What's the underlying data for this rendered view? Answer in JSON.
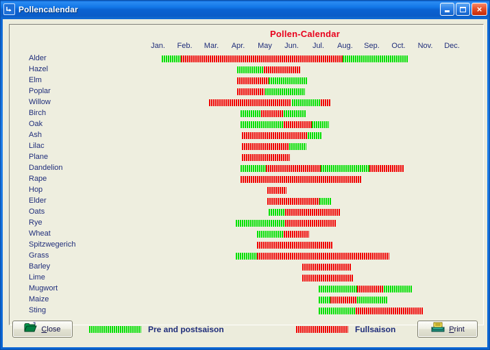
{
  "window": {
    "title": "Pollencalendar",
    "icon": "window-restore-icon",
    "minimize_label": "",
    "maximize_label": "",
    "close_label": "×"
  },
  "chart": {
    "title": "Pollen-Calendar",
    "title_color": "#E8001C",
    "label_color": "#1F2D7A",
    "background": "#EEEEDF",
    "pre_color": "#00E000",
    "full_color": "#F00000"
  },
  "legend": {
    "pre_label": "Pre and postsaison",
    "full_label": "Fullsaison"
  },
  "buttons": {
    "close": {
      "label": "Close",
      "accel": "C",
      "icon": "open-folder-icon"
    },
    "print": {
      "label": "Print",
      "accel": "P",
      "icon": "printer-icon"
    }
  },
  "chart_data": {
    "type": "bar",
    "title": "Pollen-Calendar",
    "xlabel": "",
    "ylabel": "",
    "grid": false,
    "legend_position": "bottom",
    "categories": [
      "Jan.",
      "Feb.",
      "Mar.",
      "Apr.",
      "May",
      "Jun.",
      "Jul.",
      "Aug.",
      "Sep.",
      "Oct.",
      "Nov.",
      "Dec."
    ],
    "xlim": [
      0,
      12
    ],
    "units": "months",
    "series_legend": [
      {
        "name": "Pre and postsaison",
        "color": "#00E000"
      },
      {
        "name": "Fullsaison",
        "color": "#F00000"
      }
    ],
    "rows": [
      {
        "name": "Alder",
        "segments": [
          {
            "type": "pre",
            "start": 0.65,
            "end": 1.35
          },
          {
            "type": "full",
            "start": 1.35,
            "end": 7.4
          },
          {
            "type": "pre",
            "start": 7.4,
            "end": 9.85
          }
        ]
      },
      {
        "name": "Hazel",
        "segments": [
          {
            "type": "pre",
            "start": 3.45,
            "end": 4.45
          },
          {
            "type": "full",
            "start": 4.45,
            "end": 5.85
          }
        ]
      },
      {
        "name": "Elm",
        "segments": [
          {
            "type": "full",
            "start": 3.45,
            "end": 4.65
          },
          {
            "type": "pre",
            "start": 4.65,
            "end": 6.1
          }
        ]
      },
      {
        "name": "Poplar",
        "segments": [
          {
            "type": "full",
            "start": 3.45,
            "end": 4.5
          },
          {
            "type": "pre",
            "start": 4.5,
            "end": 6.0
          }
        ]
      },
      {
        "name": "Willow",
        "segments": [
          {
            "type": "full",
            "start": 2.4,
            "end": 5.5
          },
          {
            "type": "pre",
            "start": 5.5,
            "end": 6.6
          },
          {
            "type": "full",
            "start": 6.6,
            "end": 6.95
          }
        ]
      },
      {
        "name": "Birch",
        "segments": [
          {
            "type": "pre",
            "start": 3.6,
            "end": 4.35
          },
          {
            "type": "full",
            "start": 4.35,
            "end": 5.2
          },
          {
            "type": "pre",
            "start": 5.2,
            "end": 6.05
          }
        ]
      },
      {
        "name": "Oak",
        "segments": [
          {
            "type": "pre",
            "start": 3.6,
            "end": 5.2
          },
          {
            "type": "full",
            "start": 5.2,
            "end": 6.25
          },
          {
            "type": "pre",
            "start": 6.25,
            "end": 6.9
          }
        ]
      },
      {
        "name": "Ash",
        "segments": [
          {
            "type": "full",
            "start": 3.65,
            "end": 6.1
          },
          {
            "type": "pre",
            "start": 6.1,
            "end": 6.65
          }
        ]
      },
      {
        "name": "Lilac",
        "segments": [
          {
            "type": "full",
            "start": 3.65,
            "end": 5.4
          },
          {
            "type": "pre",
            "start": 5.4,
            "end": 6.05
          }
        ]
      },
      {
        "name": "Plane",
        "segments": [
          {
            "type": "full",
            "start": 3.65,
            "end": 5.45
          }
        ]
      },
      {
        "name": "Dandelion",
        "segments": [
          {
            "type": "pre",
            "start": 3.6,
            "end": 4.55
          },
          {
            "type": "full",
            "start": 4.55,
            "end": 6.6
          },
          {
            "type": "pre",
            "start": 6.6,
            "end": 8.4
          },
          {
            "type": "full",
            "start": 8.4,
            "end": 9.7
          }
        ]
      },
      {
        "name": "Rape",
        "segments": [
          {
            "type": "full",
            "start": 3.6,
            "end": 8.1
          }
        ]
      },
      {
        "name": "Hop",
        "segments": [
          {
            "type": "full",
            "start": 4.6,
            "end": 5.3
          }
        ]
      },
      {
        "name": "Elder",
        "segments": [
          {
            "type": "full",
            "start": 4.6,
            "end": 6.55
          },
          {
            "type": "pre",
            "start": 6.55,
            "end": 7.0
          }
        ]
      },
      {
        "name": "Oats",
        "segments": [
          {
            "type": "pre",
            "start": 4.65,
            "end": 5.25
          },
          {
            "type": "full",
            "start": 5.25,
            "end": 7.3
          }
        ]
      },
      {
        "name": "Rye",
        "segments": [
          {
            "type": "pre",
            "start": 3.4,
            "end": 5.25
          },
          {
            "type": "full",
            "start": 5.25,
            "end": 7.15
          }
        ]
      },
      {
        "name": "Wheat",
        "segments": [
          {
            "type": "pre",
            "start": 4.2,
            "end": 5.2
          },
          {
            "type": "full",
            "start": 5.2,
            "end": 6.15
          }
        ]
      },
      {
        "name": "Spitzwegerich",
        "segments": [
          {
            "type": "full",
            "start": 4.2,
            "end": 7.05
          }
        ]
      },
      {
        "name": "Grass",
        "segments": [
          {
            "type": "pre",
            "start": 3.4,
            "end": 4.2
          },
          {
            "type": "full",
            "start": 4.2,
            "end": 9.15
          }
        ]
      },
      {
        "name": "Barley",
        "segments": [
          {
            "type": "full",
            "start": 5.9,
            "end": 7.75
          }
        ]
      },
      {
        "name": "Lime",
        "segments": [
          {
            "type": "full",
            "start": 5.9,
            "end": 7.8
          }
        ]
      },
      {
        "name": "Mugwort",
        "segments": [
          {
            "type": "pre",
            "start": 6.5,
            "end": 7.95
          },
          {
            "type": "full",
            "start": 7.95,
            "end": 8.95
          },
          {
            "type": "pre",
            "start": 8.95,
            "end": 10.0
          }
        ]
      },
      {
        "name": "Maize",
        "segments": [
          {
            "type": "pre",
            "start": 6.5,
            "end": 6.95
          },
          {
            "type": "full",
            "start": 6.95,
            "end": 7.95
          },
          {
            "type": "pre",
            "start": 7.95,
            "end": 9.1
          }
        ]
      },
      {
        "name": "Sting",
        "segments": [
          {
            "type": "pre",
            "start": 6.5,
            "end": 7.9
          },
          {
            "type": "full",
            "start": 7.9,
            "end": 10.45
          }
        ]
      }
    ]
  }
}
